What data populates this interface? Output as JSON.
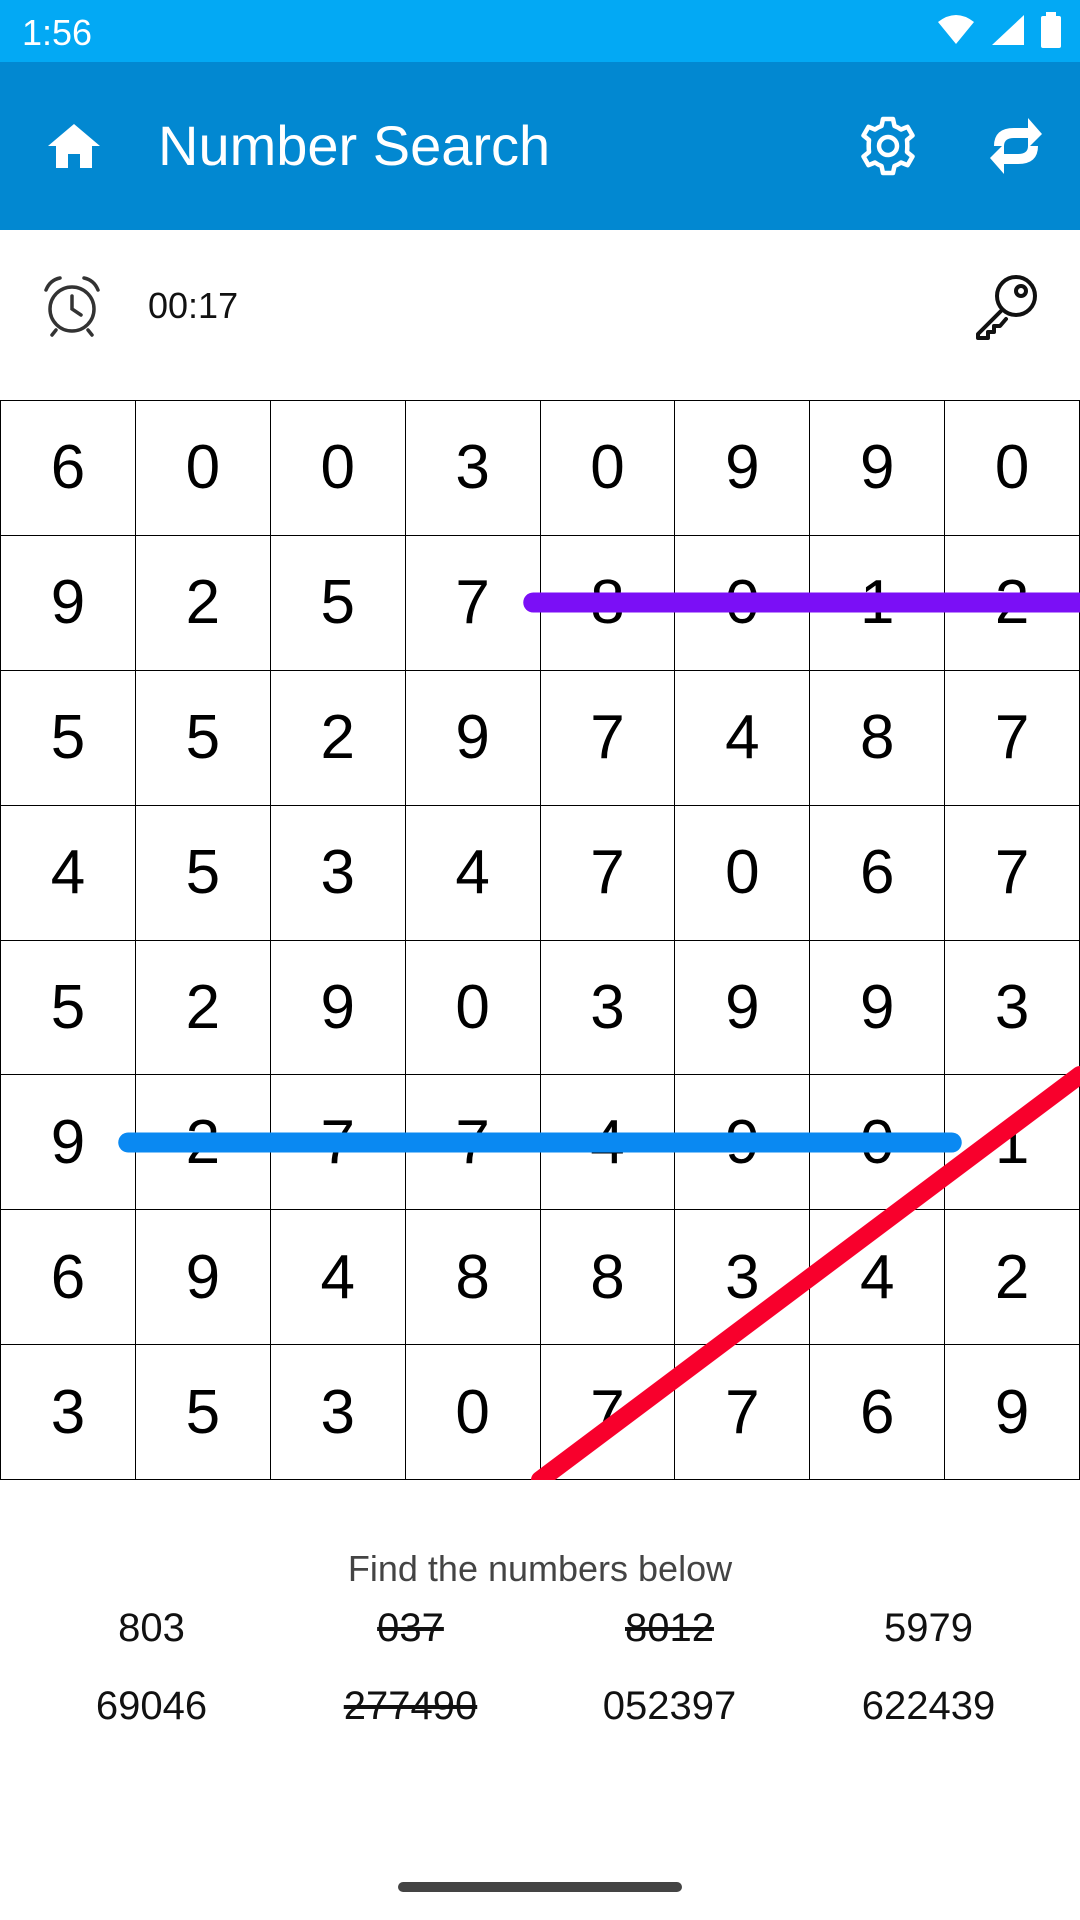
{
  "status_bar": {
    "time": "1:56",
    "icons": [
      "wifi-icon",
      "signal-icon",
      "battery-icon"
    ]
  },
  "app_bar": {
    "title": "Number Search",
    "icons": [
      "home-icon",
      "gear-icon",
      "refresh-icon"
    ]
  },
  "timer": {
    "value": "00:17",
    "icon": "alarm-clock-icon",
    "hint_icon": "key-icon"
  },
  "grid": [
    [
      6,
      0,
      0,
      3,
      0,
      9,
      9,
      0
    ],
    [
      9,
      2,
      5,
      7,
      8,
      0,
      1,
      2
    ],
    [
      5,
      5,
      2,
      9,
      7,
      4,
      8,
      7
    ],
    [
      4,
      5,
      3,
      4,
      7,
      0,
      6,
      7
    ],
    [
      5,
      2,
      9,
      0,
      3,
      9,
      9,
      3
    ],
    [
      9,
      2,
      7,
      7,
      4,
      9,
      0,
      1
    ],
    [
      6,
      9,
      4,
      8,
      8,
      3,
      4,
      2
    ],
    [
      3,
      5,
      3,
      0,
      7,
      7,
      6,
      9
    ]
  ],
  "found_lines": [
    {
      "number": "8012",
      "from": [
        1,
        4
      ],
      "to": [
        1,
        7
      ],
      "color": "#7b0ff6"
    },
    {
      "number": "277490",
      "from": [
        5,
        1
      ],
      "to": [
        5,
        6
      ],
      "color": "#0a89f2"
    },
    {
      "number": "037",
      "from": [
        5,
        7
      ],
      "to": [
        7,
        4
      ],
      "color": "#f8002c"
    }
  ],
  "word_list": {
    "instruction": "Find the numbers below",
    "words": [
      {
        "text": "803",
        "found": false
      },
      {
        "text": "037",
        "found": true
      },
      {
        "text": "8012",
        "found": true
      },
      {
        "text": "5979",
        "found": false
      },
      {
        "text": "69046",
        "found": false
      },
      {
        "text": "277490",
        "found": true
      },
      {
        "text": "052397",
        "found": false
      },
      {
        "text": "622439",
        "found": false
      }
    ]
  },
  "colors": {
    "status_bar": "#03a9f4",
    "app_bar": "#0288d1"
  }
}
